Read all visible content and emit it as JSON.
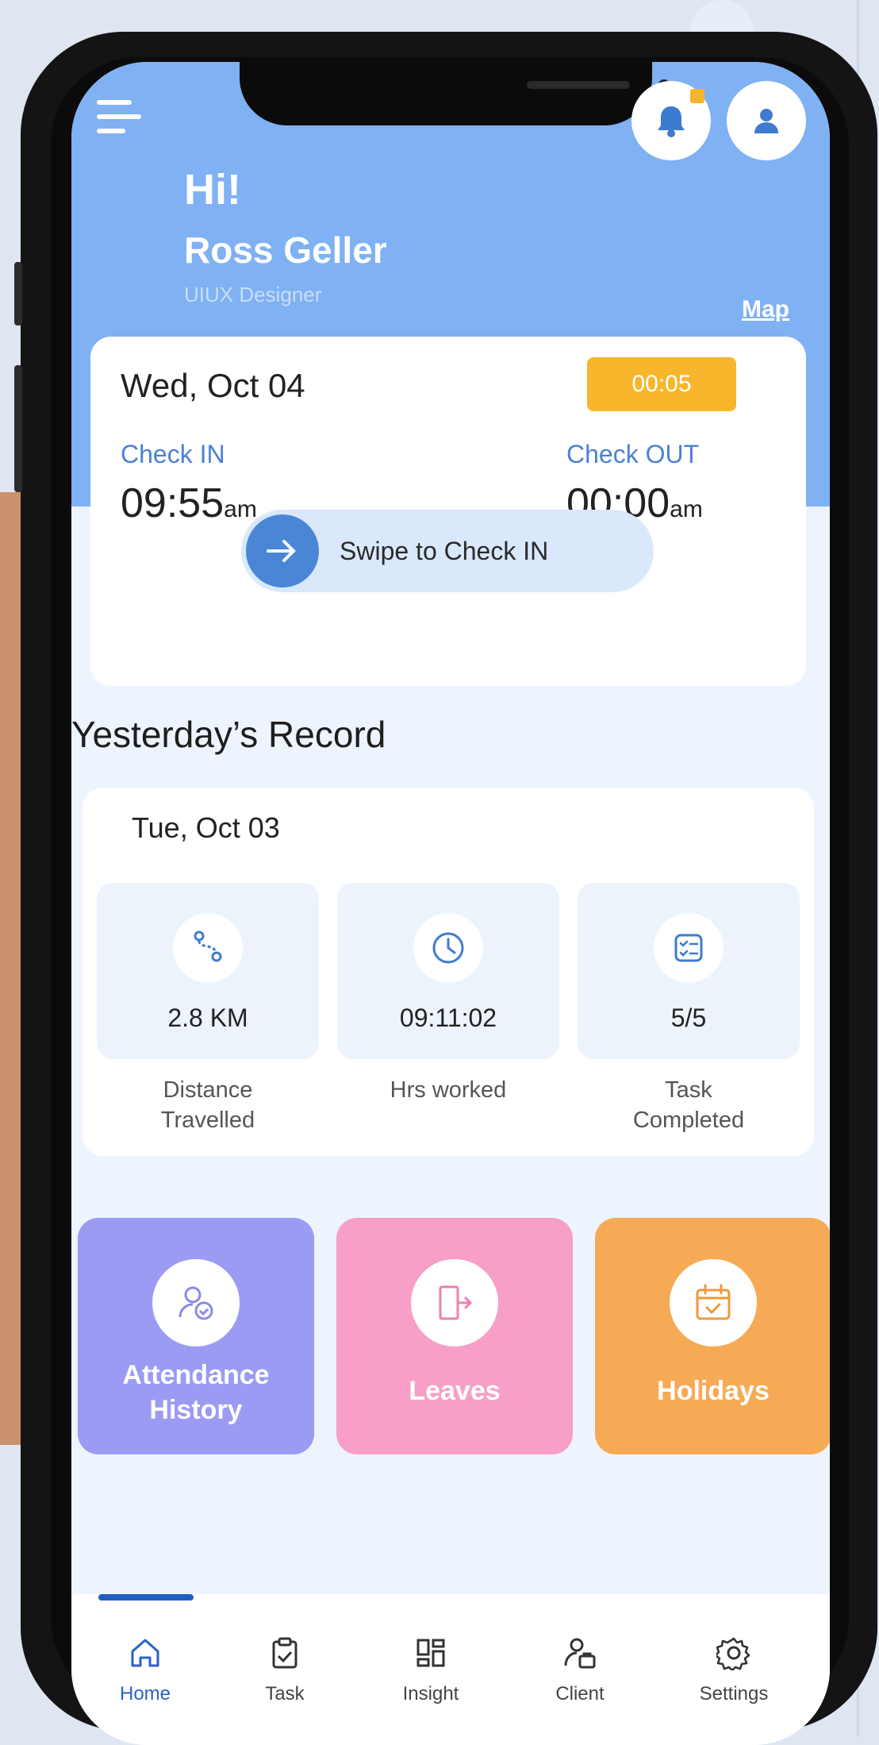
{
  "header": {
    "greeting": "Hi!",
    "user_name": "Ross Geller",
    "user_role": "UIUX Designer",
    "map_link": "Map",
    "notification_icon": "bell-icon",
    "profile_icon": "user-icon",
    "menu_icon": "hamburger-menu-icon"
  },
  "today": {
    "date": "Wed, Oct 04",
    "timer": "00:05",
    "check_in_label": "Check IN",
    "check_in_time": "09:55",
    "check_in_suffix": "am",
    "check_out_label": "Check OUT",
    "check_out_time": "00:00",
    "check_out_suffix": "am",
    "swipe_label": "Swipe to Check IN"
  },
  "yesterday": {
    "title": "Yesterday’s Record",
    "date": "Tue, Oct 03",
    "stats": [
      {
        "icon": "route-icon",
        "value": "2.8 KM",
        "label_line1": "Distance",
        "label_line2": "Travelled"
      },
      {
        "icon": "clock-icon",
        "value": "09:11:02",
        "label_line1": "Hrs worked",
        "label_line2": ""
      },
      {
        "icon": "checklist-icon",
        "value": "5/5",
        "label_line1": "Task",
        "label_line2": "Completed"
      }
    ]
  },
  "tiles": [
    {
      "line1": "Attendance",
      "line2": "History",
      "color": "#9b9bf4",
      "icon": "user-check-icon"
    },
    {
      "line1": "Leaves",
      "line2": "",
      "color": "#f79fc6",
      "icon": "exit-door-icon"
    },
    {
      "line1": "Holidays",
      "line2": "",
      "color": "#f7aa55",
      "icon": "calendar-check-icon"
    }
  ],
  "nav": {
    "items": [
      {
        "label": "Home",
        "icon": "home-icon",
        "active": true
      },
      {
        "label": "Task",
        "icon": "clipboard-check-icon",
        "active": false
      },
      {
        "label": "Insight",
        "icon": "dashboard-grid-icon",
        "active": false
      },
      {
        "label": "Client",
        "icon": "client-icon",
        "active": false
      },
      {
        "label": "Settings",
        "icon": "gear-icon",
        "active": false
      }
    ]
  },
  "colors": {
    "header_bg": "#7fb1f3",
    "accent_blue": "#4a86d6",
    "timer_bg": "#f7b62c",
    "screen_bg": "#eef4fd"
  }
}
